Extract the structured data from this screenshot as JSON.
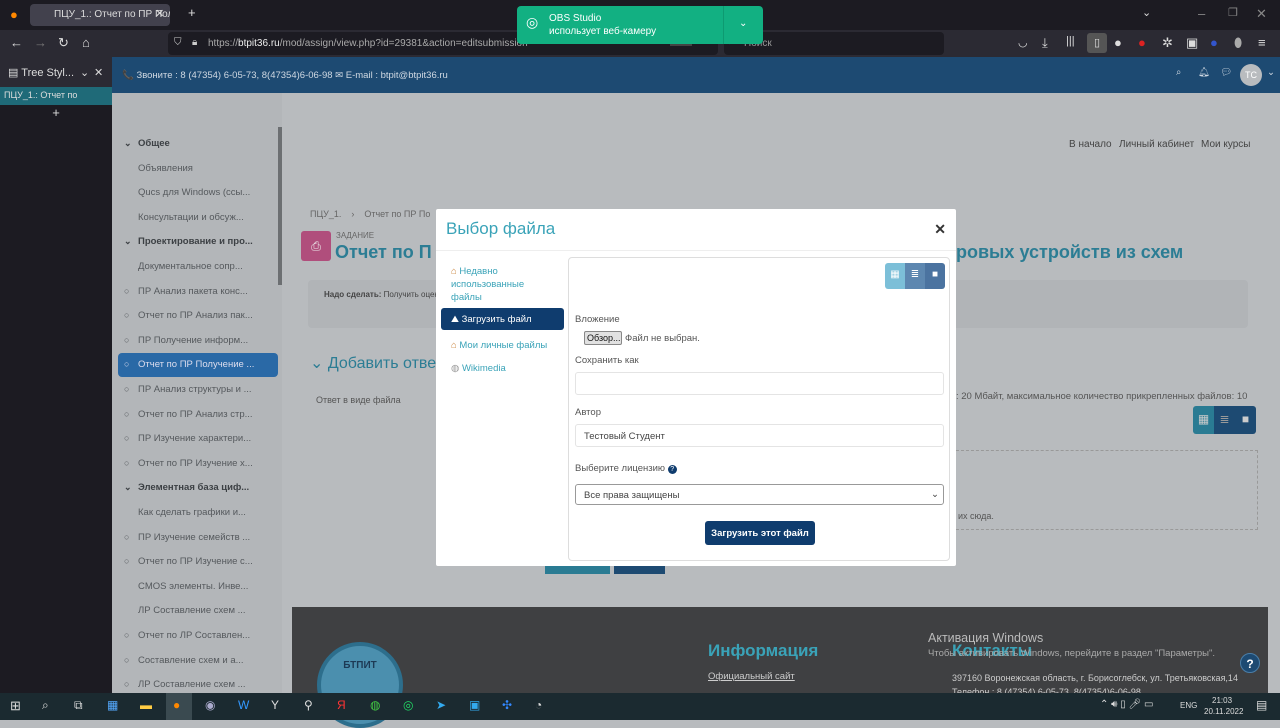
{
  "browser": {
    "tab_title": "ПЦУ_1.: Отчет по ПР Получен",
    "url_prefix": "https://",
    "url_domain": "btpit36.ru",
    "url_path": "/mod/assign/view.php?id=29381&action=editsubmission",
    "zoom": "90%",
    "search_placeholder": "Поиск"
  },
  "notification": {
    "title": "OBS Studio",
    "text": "использует веб-камеру"
  },
  "tree_style_tab": {
    "title": "Tree Styl...",
    "tab": "ПЦУ_1.: Отчет по"
  },
  "site_header": {
    "contacts": "📞 Звоните : 8 (47354) 6-05-73, 8(47354)6-06-98  ✉ E-mail : btpit@btpit36.ru",
    "avatar": "TC"
  },
  "top_nav": [
    "В начало",
    "Личный кабинет",
    "Мои курсы"
  ],
  "sidebar": {
    "items": [
      {
        "label": "Общее",
        "type": "section"
      },
      {
        "label": "Объявления",
        "type": "plain"
      },
      {
        "label": "Qucs для Windows (ссы...",
        "type": "plain"
      },
      {
        "label": "Консультации и обсуж...",
        "type": "plain"
      },
      {
        "label": "Проектирование и про...",
        "type": "section"
      },
      {
        "label": "Документальное сопр...",
        "type": "plain"
      },
      {
        "label": "ПР Анализ пакета конс...",
        "type": "circle"
      },
      {
        "label": "Отчет по ПР Анализ пак...",
        "type": "circle"
      },
      {
        "label": "ПР Получение информ...",
        "type": "circle"
      },
      {
        "label": "Отчет по ПР Получение ...",
        "type": "active"
      },
      {
        "label": "ПР Анализ структуры и ...",
        "type": "circle"
      },
      {
        "label": "Отчет по ПР Анализ стр...",
        "type": "circle"
      },
      {
        "label": "ПР Изучение характери...",
        "type": "circle"
      },
      {
        "label": "Отчет по ПР Изучение х...",
        "type": "circle"
      },
      {
        "label": "Элементная база циф...",
        "type": "section"
      },
      {
        "label": "Как сделать графики и...",
        "type": "plain"
      },
      {
        "label": "ПР Изучение семейств ...",
        "type": "circle"
      },
      {
        "label": "Отчет по ПР Изучение с...",
        "type": "circle"
      },
      {
        "label": "CMOS элементы. Инве...",
        "type": "plain"
      },
      {
        "label": "ЛР Составление схем ...",
        "type": "plain"
      },
      {
        "label": "Отчет по ЛР Составлен...",
        "type": "circle"
      },
      {
        "label": "Составление схем и а...",
        "type": "circle"
      },
      {
        "label": "ЛР Составление схем ...",
        "type": "circle"
      }
    ]
  },
  "page": {
    "breadcrumb": [
      "ПЦУ_1.",
      "Отчет по ПР По"
    ],
    "label": "ЗАДАНИЕ",
    "title_left": "Отчет по П",
    "title_right": "ровых устройств из схем",
    "todo_label": "Надо сделать:",
    "todo_text": "Получить оценк",
    "section": "Добавить отве",
    "file_answer": "Ответ в виде файла",
    "limits": ": 20 Мбайт, максимальное количество прикрепленных файлов: 10",
    "drop_hint": "их сюда."
  },
  "footer": {
    "info_title": "Информация",
    "info_link": "Официальный сайт",
    "contacts_title": "Контакты",
    "address": "397160 Воронежская область, г. Борисоглебск, ул. Третьяковская,14",
    "phone": "Телефон : 8 (47354) 6-05-73, 8(47354)6-06-98",
    "logo_text": "БТПИТ",
    "activation_title": "Активация Windows",
    "activation_text": "Чтобы активировать Windows, перейдите в раздел \"Параметры\"."
  },
  "modal": {
    "title": "Выбор файла",
    "nav": [
      "Недавно использованные файлы",
      "Загрузить файл",
      "Мои личные файлы",
      "Wikimedia"
    ],
    "attachment_label": "Вложение",
    "browse_button": "Обзор...",
    "no_file": "Файл не выбран.",
    "save_as_label": "Сохранить как",
    "save_as_value": "",
    "author_label": "Автор",
    "author_value": "Тестовый  Студент",
    "license_label": "Выберите лицензию",
    "license_value": "Все права защищены",
    "upload_button": "Загрузить этот файл"
  },
  "taskbar": {
    "lang": "ENG",
    "time": "21:03",
    "date": "20.11.2022"
  },
  "colors": {
    "site_header": "#1d4a72",
    "accent": "#3aa3b8",
    "primary_button": "#0f3c6e",
    "active_sidebar": "#2a69a6",
    "notification": "#12b082"
  }
}
